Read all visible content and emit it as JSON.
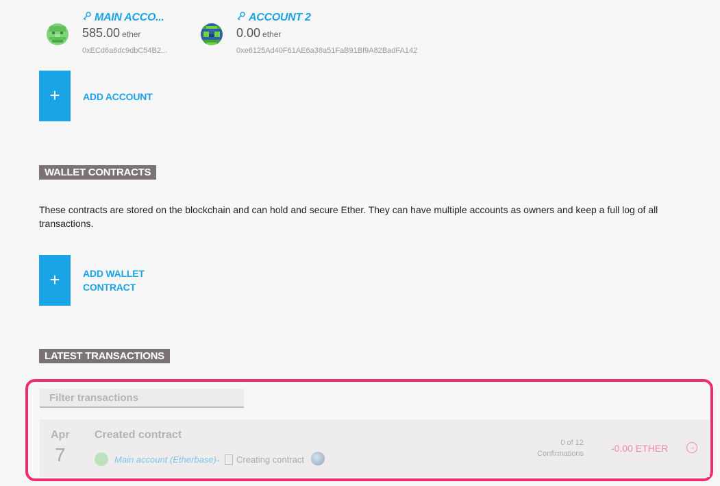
{
  "accounts": [
    {
      "name": "MAIN ACCO...",
      "balance": "585.00",
      "unit": "ether",
      "address": "0xECd6a6dc9dbC54B2...",
      "avatar_color": "#6fcf6a",
      "icon": "key-icon"
    },
    {
      "name": "ACCOUNT 2",
      "balance": "0.00",
      "unit": "ether",
      "address": "0xe6125Ad40F61AE6a38a51FaB91Bf9A82BadFA142",
      "avatar_color": "#3f8a2f",
      "icon": "key-icon"
    }
  ],
  "add_account": {
    "icon": "+",
    "label": "ADD ACCOUNT"
  },
  "wallet_contracts": {
    "title": "WALLET CONTRACTS",
    "description": "These contracts are stored on the blockchain and can hold and secure Ether. They can have multiple accounts as owners and keep a full log of all transactions.",
    "add_icon": "+",
    "add_label_line1": "ADD WALLET",
    "add_label_line2": "CONTRACT"
  },
  "latest_transactions": {
    "title": "LATEST TRANSACTIONS",
    "filter_placeholder": "Filter transactions",
    "items": [
      {
        "month": "Apr",
        "day": "7",
        "title": "Created contract",
        "from": "Main account (Etherbase)",
        "arrow": "→",
        "to": "Creating contract",
        "confirmations_count": "0 of 12",
        "confirmations_label": "Confirmations",
        "amount": "-0.00 ETHER",
        "go_icon": "→"
      }
    ]
  },
  "colors": {
    "accent": "#1aa3e6",
    "section_title_bg": "#7a7374",
    "highlight": "#ee2d6a",
    "negative_amount": "#f08aa0"
  }
}
